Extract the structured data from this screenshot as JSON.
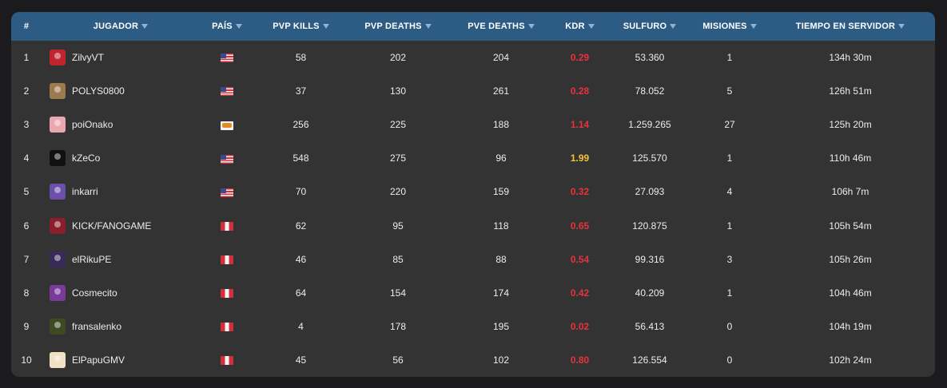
{
  "columns": [
    {
      "label": "#",
      "sortable": false
    },
    {
      "label": "JUGADOR",
      "sortable": true
    },
    {
      "label": "PAÍS",
      "sortable": true
    },
    {
      "label": "PVP KILLS",
      "sortable": true
    },
    {
      "label": "PVP DEATHS",
      "sortable": true
    },
    {
      "label": "PVE DEATHS",
      "sortable": true
    },
    {
      "label": "KDR",
      "sortable": true
    },
    {
      "label": "SULFURO",
      "sortable": true
    },
    {
      "label": "MISIONES",
      "sortable": true
    },
    {
      "label": "TIEMPO EN SERVIDOR",
      "sortable": true
    }
  ],
  "colors": {
    "header_bg": "#2c5b84",
    "card_bg": "#333334",
    "page_bg": "#1b1b1d",
    "kdr_low": "#e8323c",
    "kdr_high": "#f3c534"
  },
  "rows": [
    {
      "rank": "1",
      "player": "ZilvyVT",
      "avatar_color": "#c0242e",
      "country": "us",
      "pvp_kills": "58",
      "pvp_deaths": "202",
      "pve_deaths": "204",
      "kdr": "0.29",
      "kdr_color": "#e8323c",
      "sulfuro": "53.360",
      "misiones": "1",
      "tiempo": "134h 30m"
    },
    {
      "rank": "2",
      "player": "POLYS0800",
      "avatar_color": "#9a7a4e",
      "country": "us",
      "pvp_kills": "37",
      "pvp_deaths": "130",
      "pve_deaths": "261",
      "kdr": "0.28",
      "kdr_color": "#e8323c",
      "sulfuro": "78.052",
      "misiones": "5",
      "tiempo": "126h 51m"
    },
    {
      "rank": "3",
      "player": "poiOnako",
      "avatar_color": "#e9a8b0",
      "country": "cy",
      "pvp_kills": "256",
      "pvp_deaths": "225",
      "pve_deaths": "188",
      "kdr": "1.14",
      "kdr_color": "#e8323c",
      "sulfuro": "1.259.265",
      "misiones": "27",
      "tiempo": "125h 20m"
    },
    {
      "rank": "4",
      "player": "kZeCo",
      "avatar_color": "#111111",
      "country": "us",
      "pvp_kills": "548",
      "pvp_deaths": "275",
      "pve_deaths": "96",
      "kdr": "1.99",
      "kdr_color": "#f3c534",
      "sulfuro": "125.570",
      "misiones": "1",
      "tiempo": "110h 46m"
    },
    {
      "rank": "5",
      "player": "inkarri",
      "avatar_color": "#6c4fa8",
      "country": "us",
      "pvp_kills": "70",
      "pvp_deaths": "220",
      "pve_deaths": "159",
      "kdr": "0.32",
      "kdr_color": "#e8323c",
      "sulfuro": "27.093",
      "misiones": "4",
      "tiempo": "106h 7m"
    },
    {
      "rank": "6",
      "player": "KICK/FANOGAME",
      "avatar_color": "#8a1e2a",
      "country": "pe",
      "pvp_kills": "62",
      "pvp_deaths": "95",
      "pve_deaths": "118",
      "kdr": "0.65",
      "kdr_color": "#e8323c",
      "sulfuro": "120.875",
      "misiones": "1",
      "tiempo": "105h 54m"
    },
    {
      "rank": "7",
      "player": "elRikuPE",
      "avatar_color": "#3a2a5a",
      "country": "pe",
      "pvp_kills": "46",
      "pvp_deaths": "85",
      "pve_deaths": "88",
      "kdr": "0.54",
      "kdr_color": "#e8323c",
      "sulfuro": "99.316",
      "misiones": "3",
      "tiempo": "105h 26m"
    },
    {
      "rank": "8",
      "player": "Cosmecito",
      "avatar_color": "#7a3a9a",
      "country": "pe",
      "pvp_kills": "64",
      "pvp_deaths": "154",
      "pve_deaths": "174",
      "kdr": "0.42",
      "kdr_color": "#e8323c",
      "sulfuro": "40.209",
      "misiones": "1",
      "tiempo": "104h 46m"
    },
    {
      "rank": "9",
      "player": "fransalenko",
      "avatar_color": "#3e4a22",
      "country": "pe",
      "pvp_kills": "4",
      "pvp_deaths": "178",
      "pve_deaths": "195",
      "kdr": "0.02",
      "kdr_color": "#e8323c",
      "sulfuro": "56.413",
      "misiones": "0",
      "tiempo": "104h 19m"
    },
    {
      "rank": "10",
      "player": "ElPapuGMV",
      "avatar_color": "#f1e2c4",
      "country": "pe",
      "pvp_kills": "45",
      "pvp_deaths": "56",
      "pve_deaths": "102",
      "kdr": "0.80",
      "kdr_color": "#e8323c",
      "sulfuro": "126.554",
      "misiones": "0",
      "tiempo": "102h 24m"
    }
  ]
}
